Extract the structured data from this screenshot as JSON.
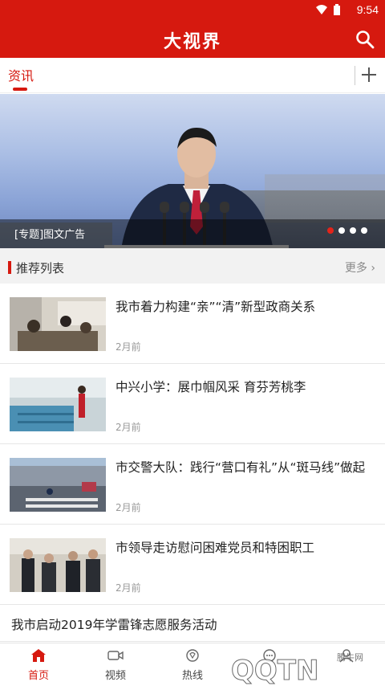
{
  "status_bar": {
    "time": "9:54",
    "icons": [
      "wifi-icon",
      "battery-icon"
    ]
  },
  "app_bar": {
    "title": "大视界",
    "icons": [
      "search-icon"
    ]
  },
  "tabs": {
    "active_label": "资讯",
    "icons": [
      "add-icon"
    ]
  },
  "banner": {
    "caption": "[专题]图文广告",
    "slide_count": 4,
    "active_slide": 1
  },
  "section": {
    "title": "推荐列表",
    "more_label": "更多"
  },
  "news": [
    {
      "headline": "我市着力构建“亲”“清”新型政商关系",
      "time": "2月前"
    },
    {
      "headline": "中兴小学：展巾帼风采 育芬芳桃李",
      "time": "2月前"
    },
    {
      "headline": "市交警大队：践行“营口有礼”从“斑马线”做起",
      "time": "2月前"
    },
    {
      "headline": "市领导走访慰问困难党员和特困职工",
      "time": "2月前"
    }
  ],
  "text_item": {
    "headline": "我市启动2019年学雷锋志愿服务活动"
  },
  "bottom_nav": [
    {
      "label": "首页",
      "icon": "home-icon",
      "active": true
    },
    {
      "label": "视频",
      "icon": "video-icon",
      "active": false
    },
    {
      "label": "热线",
      "icon": "hotline-icon",
      "active": false
    },
    {
      "label": "",
      "icon": "chat-icon",
      "active": false
    },
    {
      "label": "",
      "icon": "user-icon",
      "active": false
    }
  ],
  "watermark": {
    "text": "QQTN",
    "sub_text": "腾牛网"
  },
  "colors": {
    "brand": "#d6190f",
    "accent_dot": "#e3241a"
  }
}
